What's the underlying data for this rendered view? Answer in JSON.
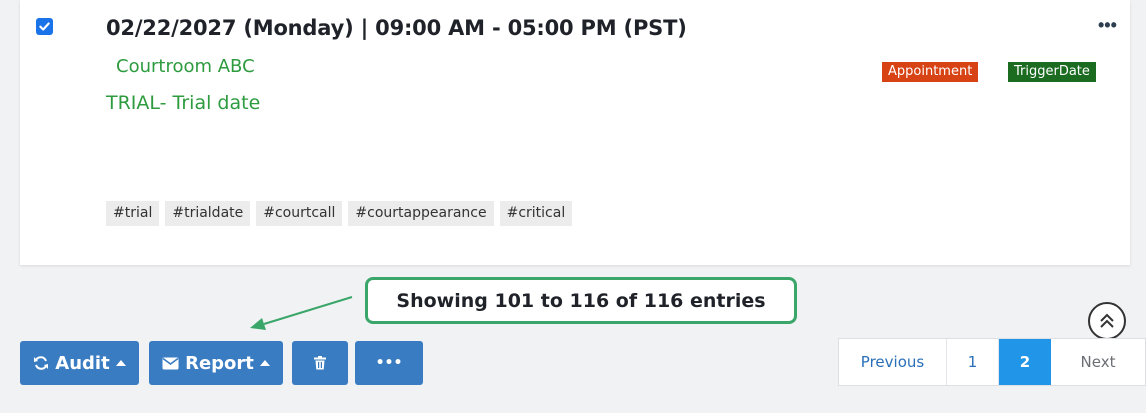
{
  "event": {
    "date_line": "02/22/2027 (Monday)  |  09:00 AM - 05:00 PM (PST)",
    "location": "Courtroom ABC",
    "title": "TRIAL- Trial date",
    "checked": true,
    "more_menu": "•••",
    "badges": [
      {
        "label": "Appointment",
        "color": "#d84315"
      },
      {
        "label": "TriggerDate",
        "color": "#1b6b21"
      }
    ],
    "tags": [
      "#trial",
      "#trialdate",
      "#courtcall",
      "#courtappearance",
      "#critical"
    ]
  },
  "info": {
    "entries_text": "Showing 101 to 116 of 116 entries"
  },
  "toolbar": {
    "audit_label": "Audit",
    "report_label": "Report",
    "more_label": "•••",
    "color": "#3a7cc2"
  },
  "pagination": {
    "previous": "Previous",
    "pages": [
      "1",
      "2"
    ],
    "current": "2",
    "next": "Next",
    "active_color": "#2196e8"
  },
  "colors": {
    "accent_green": "#2e9b3f",
    "callout_border": "#3aa66a"
  }
}
